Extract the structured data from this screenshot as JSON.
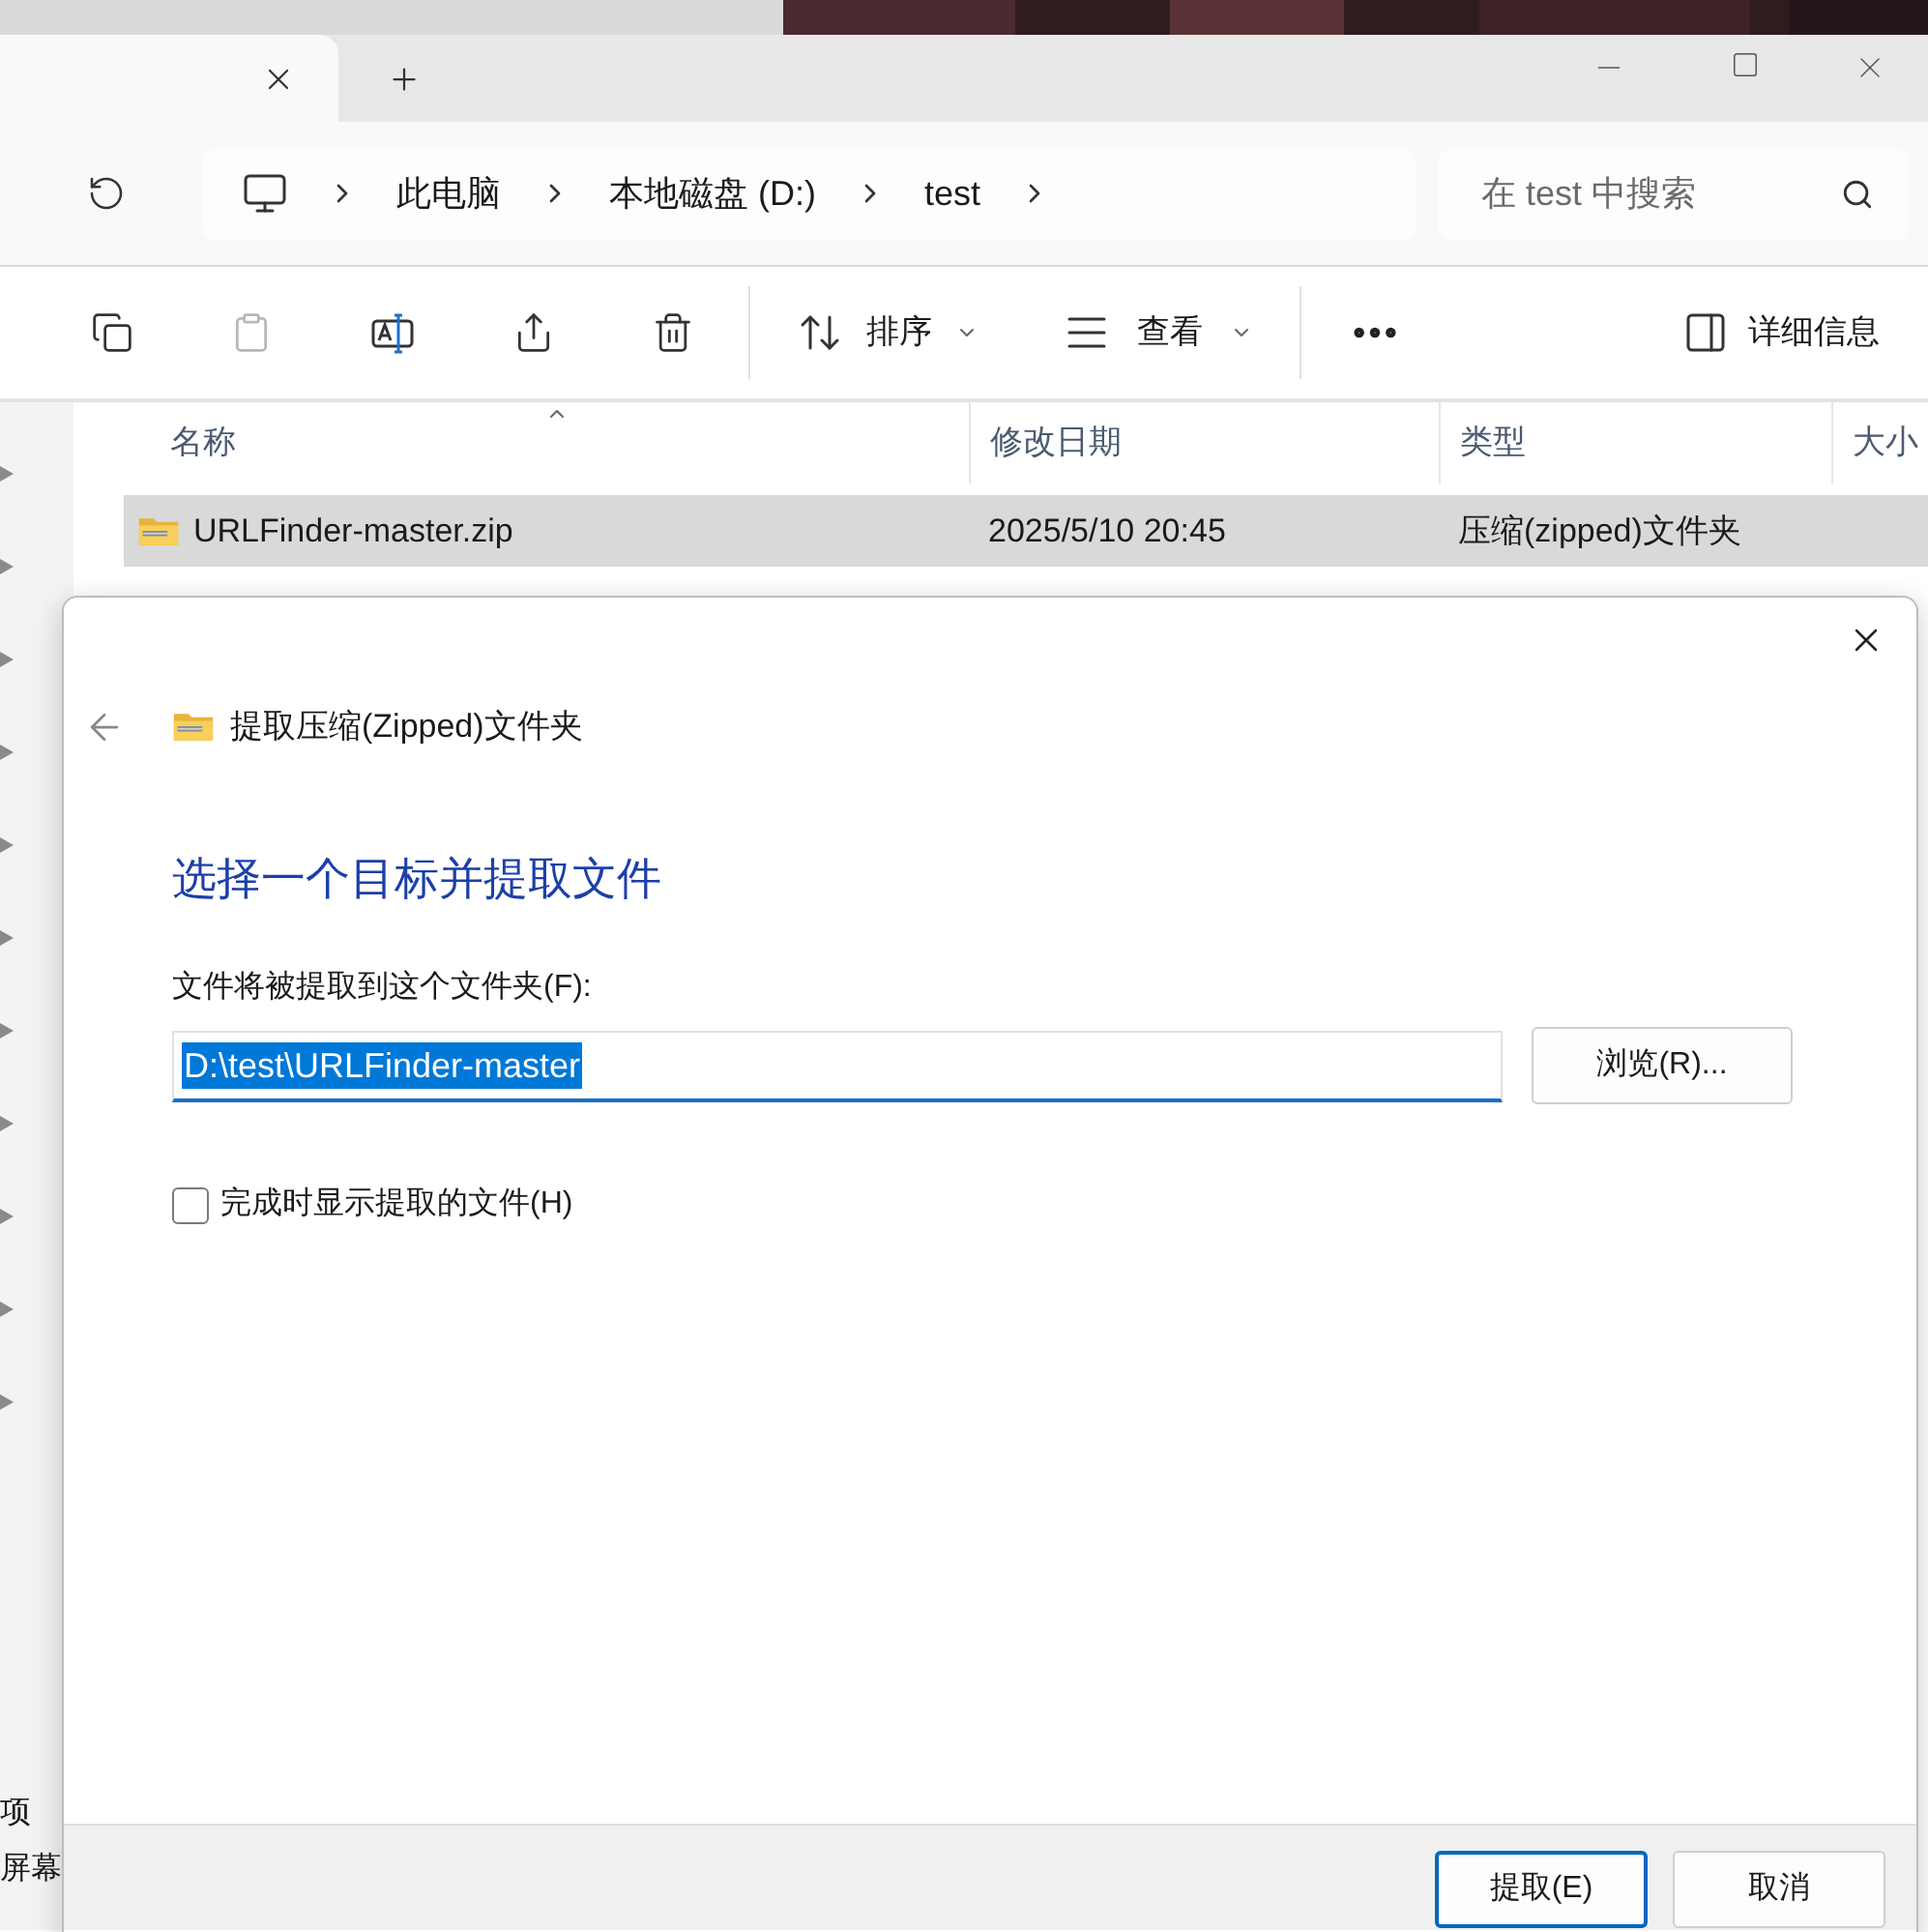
{
  "breadcrumb": [
    "此电脑",
    "本地磁盘 (D:)",
    "test"
  ],
  "search": {
    "placeholder": "在 test 中搜索"
  },
  "toolbar": {
    "actions": [
      {
        "kind": "copy",
        "disabled": false
      },
      {
        "kind": "paste",
        "disabled": true
      },
      {
        "kind": "rename",
        "disabled": false
      },
      {
        "kind": "share",
        "disabled": false
      },
      {
        "kind": "delete",
        "disabled": false
      }
    ],
    "sort": "排序",
    "view": "查看",
    "details": "详细信息"
  },
  "table": {
    "columns": [
      "名称",
      "修改日期",
      "类型",
      "大小"
    ],
    "rows": [
      {
        "name": "URLFinder-master.zip",
        "modified": "2025/5/10 20:45",
        "type": "压缩(zipped)文件夹",
        "selected": true
      }
    ]
  },
  "status_bar": [
    "项",
    "屏幕"
  ],
  "dialog": {
    "title": "提取压缩(Zipped)文件夹",
    "heading": "选择一个目标并提取文件",
    "label": "文件将被提取到这个文件夹(F):",
    "path": {
      "value": "D:\\test\\URLFinder-master",
      "selected": true
    },
    "browse": "浏览(R)...",
    "option": {
      "label": "完成时显示提取的文件(H)",
      "checked": false
    },
    "buttons": [
      {
        "label": "提取(E)",
        "kind": "primary"
      },
      {
        "label": "取消",
        "kind": "secondary"
      }
    ]
  }
}
